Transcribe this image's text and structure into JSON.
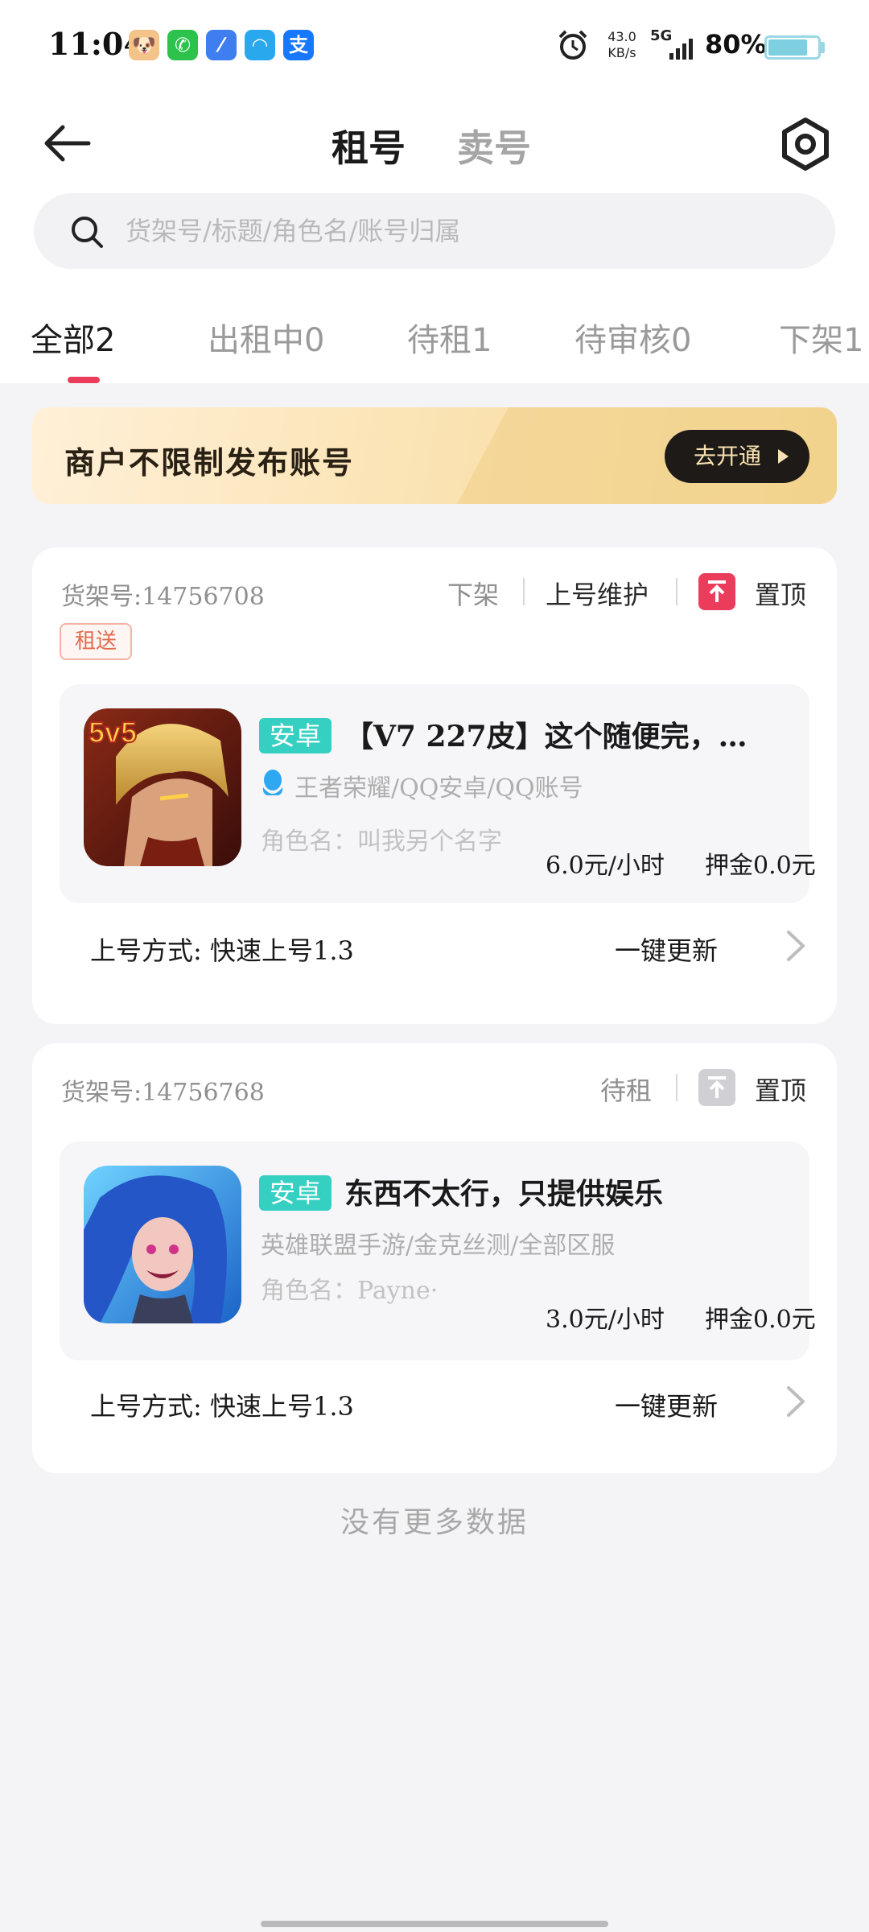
{
  "status_bar": {
    "time": "11:04",
    "apps": [
      {
        "icon": "emoji-app-icon",
        "glyph": "🐶",
        "color": "#f3c389"
      },
      {
        "icon": "wechat-icon",
        "glyph": "✆",
        "color": "#2dc24b"
      },
      {
        "icon": "feather-app-icon",
        "glyph": "⁄",
        "color": "#3f7ef0"
      },
      {
        "icon": "browser-app-icon",
        "glyph": "◠",
        "color": "#2aa8ee"
      },
      {
        "icon": "alipay-icon",
        "glyph": "支",
        "color": "#1677ff"
      }
    ],
    "net_speed_value": "43.0",
    "net_speed_unit": "KB/s",
    "network": "5G",
    "battery": "80%",
    "battery_level": 0.8
  },
  "header": {
    "tab_rent": "租号",
    "tab_sell": "卖号"
  },
  "search": {
    "placeholder": "货架号/标题/角色名/账号归属"
  },
  "tabs": [
    {
      "label": "全部2"
    },
    {
      "label": "出租中0"
    },
    {
      "label": "待租1"
    },
    {
      "label": "待审核0"
    },
    {
      "label": "下架1"
    }
  ],
  "promo": {
    "text": "商户不限制发布账号",
    "button": "去开通"
  },
  "listings": [
    {
      "shelf_label": "货架号:14756708",
      "action_offshelf": "下架",
      "action_maintain": "上号维护",
      "action_pin": "置顶",
      "badge": "租送",
      "system_tag": "安卓",
      "title": "【V7 227皮】这个随便完，…",
      "game_info": "王者荣耀/QQ安卓/QQ账号",
      "role_name": "角色名：叫我另个名字",
      "price": "6.0元/小时",
      "deposit": "押金0.0元",
      "login_method": "上号方式: 快速上号1.3",
      "update": "一键更新"
    },
    {
      "shelf_label": "货架号:14756768",
      "status": "待租",
      "action_pin": "置顶",
      "system_tag": "安卓",
      "title": "东西不太行，只提供娱乐",
      "game_info": "英雄联盟手游/金克丝测/全部区服",
      "role_name": "角色名：Payne·",
      "price": "3.0元/小时",
      "deposit": "押金0.0元",
      "login_method": "上号方式: 快速上号1.3",
      "update": "一键更新"
    }
  ],
  "footer": {
    "no_more": "没有更多数据"
  },
  "colors": {
    "accent": "#ec3c5c",
    "system_tag": "#36d0c2",
    "pin_active": "#ec3c5c",
    "pin_inactive": "#d0d0d4"
  }
}
